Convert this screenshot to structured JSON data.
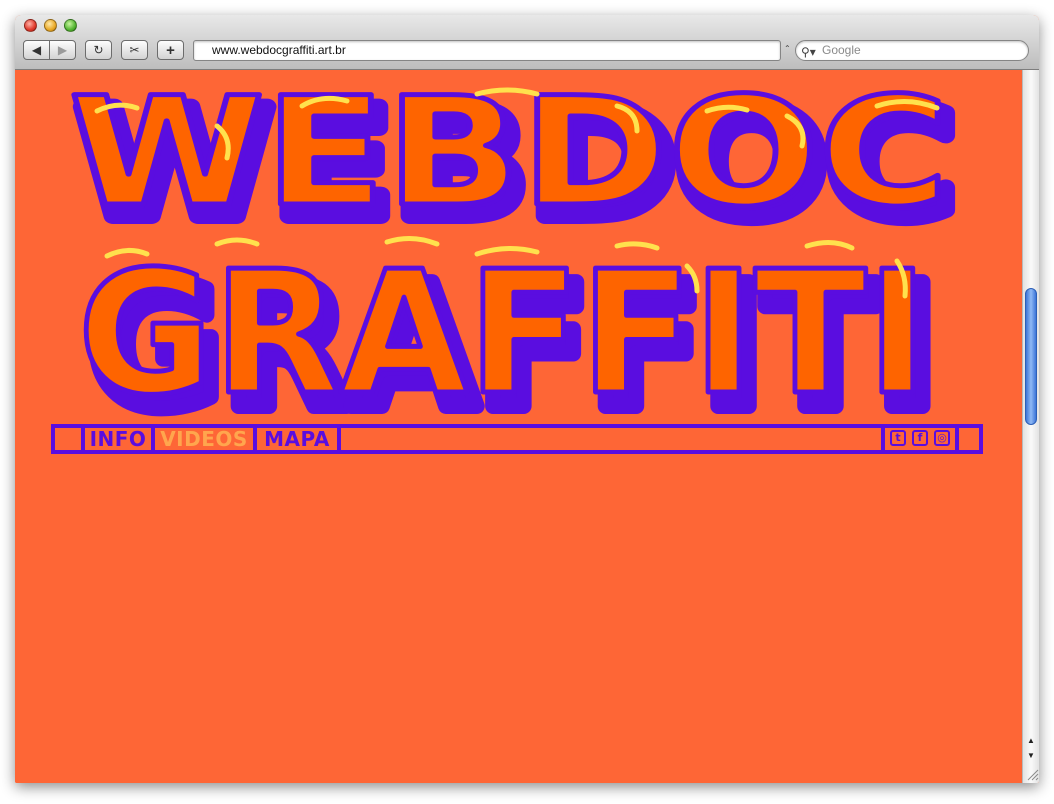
{
  "browser": {
    "url": "www.webdocgraffiti.art.br",
    "search_placeholder": "Google",
    "buttons": {
      "back": "◀",
      "forward": "▶",
      "reload": "↻",
      "snip": "✂",
      "add": "+"
    },
    "search_icon": "magnifier-icon",
    "rss_indicator": "⌃"
  },
  "site": {
    "logo_line1": "WEBDOC",
    "logo_line2": "GRAFFITI",
    "nav": {
      "items": [
        {
          "label": "INFO"
        },
        {
          "label": "VIDEOS"
        },
        {
          "label": "MAPA"
        }
      ],
      "social": [
        {
          "icon": "twitter-icon",
          "glyph": "t"
        },
        {
          "icon": "facebook-icon",
          "glyph": "f"
        },
        {
          "icon": "instagram-icon",
          "glyph": "◎"
        }
      ]
    }
  },
  "colors": {
    "background": "#fe6636",
    "logo_fill": "#fe6400",
    "logo_shadow": "#5a0de0",
    "highlight": "#ffe14d",
    "nav_active": "#ffa64d"
  }
}
